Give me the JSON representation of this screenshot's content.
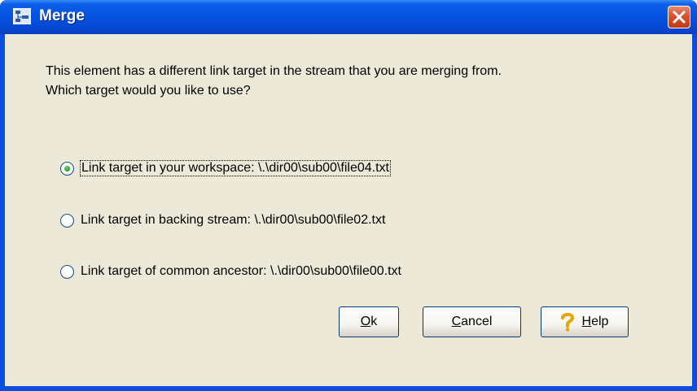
{
  "dialog": {
    "title": "Merge",
    "message_line1": "This element has a different link target in the stream that you are merging from.",
    "message_line2": "Which target would you like to use?",
    "options": [
      {
        "label": "Link target in your workspace: \\.\\dir00\\sub00\\file04.txt",
        "selected": true
      },
      {
        "label": "Link target in backing stream: \\.\\dir00\\sub00\\file02.txt",
        "selected": false
      },
      {
        "label": "Link target of common ancestor: \\.\\dir00\\sub00\\file00.txt",
        "selected": false
      }
    ],
    "buttons": {
      "ok": "Ok",
      "cancel": "Cancel",
      "help": "Help"
    }
  },
  "icons": {
    "app": "merge-app-icon",
    "close": "close-icon",
    "help": "question-mark-icon"
  },
  "colors": {
    "titlebar": "#0553e0",
    "client": "#ece9d8",
    "close": "#d8512f",
    "radio_dot": "#24a024"
  }
}
